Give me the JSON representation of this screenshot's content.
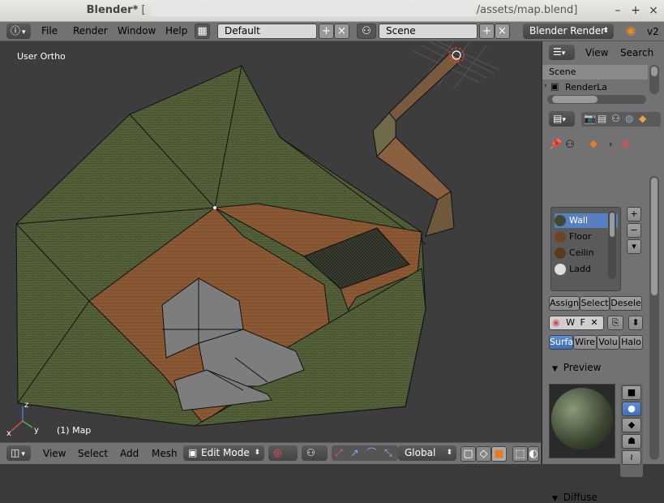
{
  "window": {
    "app_title": "Blender*",
    "bracket_open": "[",
    "path_tail": "/assets/map.blend]",
    "version": "v2"
  },
  "topbar": {
    "menu": [
      "File",
      "Render",
      "Window",
      "Help"
    ],
    "layout_value": "Default",
    "scene_value": "Scene",
    "engine_value": "Blender Render"
  },
  "viewport": {
    "view_label": "User Ortho",
    "object_label": "(1) Map",
    "axis_x": "x",
    "axis_y": "y",
    "axis_z": "z"
  },
  "footer": {
    "menu": [
      "View",
      "Select",
      "Add",
      "Mesh"
    ],
    "mode_value": "Edit Mode",
    "orientation_value": "Global"
  },
  "outliner": {
    "view_label": "View",
    "search_label": "Search",
    "items": [
      "Scene",
      "RenderLa"
    ]
  },
  "properties": {
    "materials": [
      {
        "name": "Wall",
        "color": "#3f4a35",
        "selected": true
      },
      {
        "name": "Floor",
        "color": "#6b4526",
        "selected": false
      },
      {
        "name": "Ceilin",
        "color": "#5b3a1f",
        "selected": false
      },
      {
        "name": "Ladd",
        "color": "#dddddd",
        "selected": false
      }
    ],
    "assign_buttons": [
      "Assign",
      "Select",
      "Desele"
    ],
    "slot_letters": [
      "W",
      "F"
    ],
    "shading_tabs": [
      "Surfa",
      "Wire",
      "Volu",
      "Halo"
    ],
    "preview_label": "Preview",
    "diffuse_label": "Diffuse"
  },
  "colors": {
    "accent": "#5680c2",
    "wall_green": "#4a5633",
    "floor_brown": "#8b5a34",
    "stairs_gray": "#7d7d7d"
  }
}
